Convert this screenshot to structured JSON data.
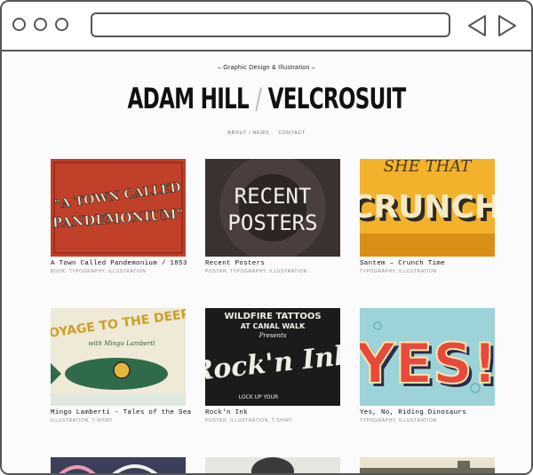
{
  "site": {
    "tagline": "– Graphic Design & Illustration –",
    "brand_name": "ADAM HILL",
    "brand_slash": "/",
    "brand_alias": "VELCROSUIT",
    "nav": [
      "ABOUT / NEWS",
      "CONTACT"
    ]
  },
  "projects": [
    {
      "title": "A Town Called Pandemonium / 1853",
      "tags": "BOOK, TYPOGRAPHY, ILLUSTRATION",
      "art": [
        "\"A TOWN CALLED",
        "PANDEMONIUM\""
      ]
    },
    {
      "title": "Recent Posters",
      "tags": "POSTER, TYPOGRAPHY, ILLUSTRATION",
      "art": [
        "RECENT",
        "POSTERS"
      ]
    },
    {
      "title": "Santem – Crunch Time",
      "tags": "TYPOGRAPHY, ILLUSTRATION",
      "art": [
        "SHE THAT",
        "CRUNCH"
      ]
    },
    {
      "title": "Mingo Lamberti - Tales of the Sea",
      "tags": "ILLUSTRATION, T-SHIRT",
      "art": [
        "VOYAGE TO THE DEEP!",
        "with Mingo Lamberti"
      ]
    },
    {
      "title": "Rock'n Ink",
      "tags": "POSTER, ILLUSTRATION, T-SHIRT",
      "art": [
        "WILDFIRE TATTOOS",
        "AT CANAL WALK",
        "Presents",
        "Rock'n Ink",
        "LOCK UP YOUR"
      ]
    },
    {
      "title": "Yes, No, Riding Dinosaurs",
      "tags": "TYPOGRAPHY, ILLUSTRATION",
      "art": [
        "YES!"
      ]
    }
  ],
  "colors": {
    "frame": "#555555",
    "page": "#fbfbfb"
  }
}
